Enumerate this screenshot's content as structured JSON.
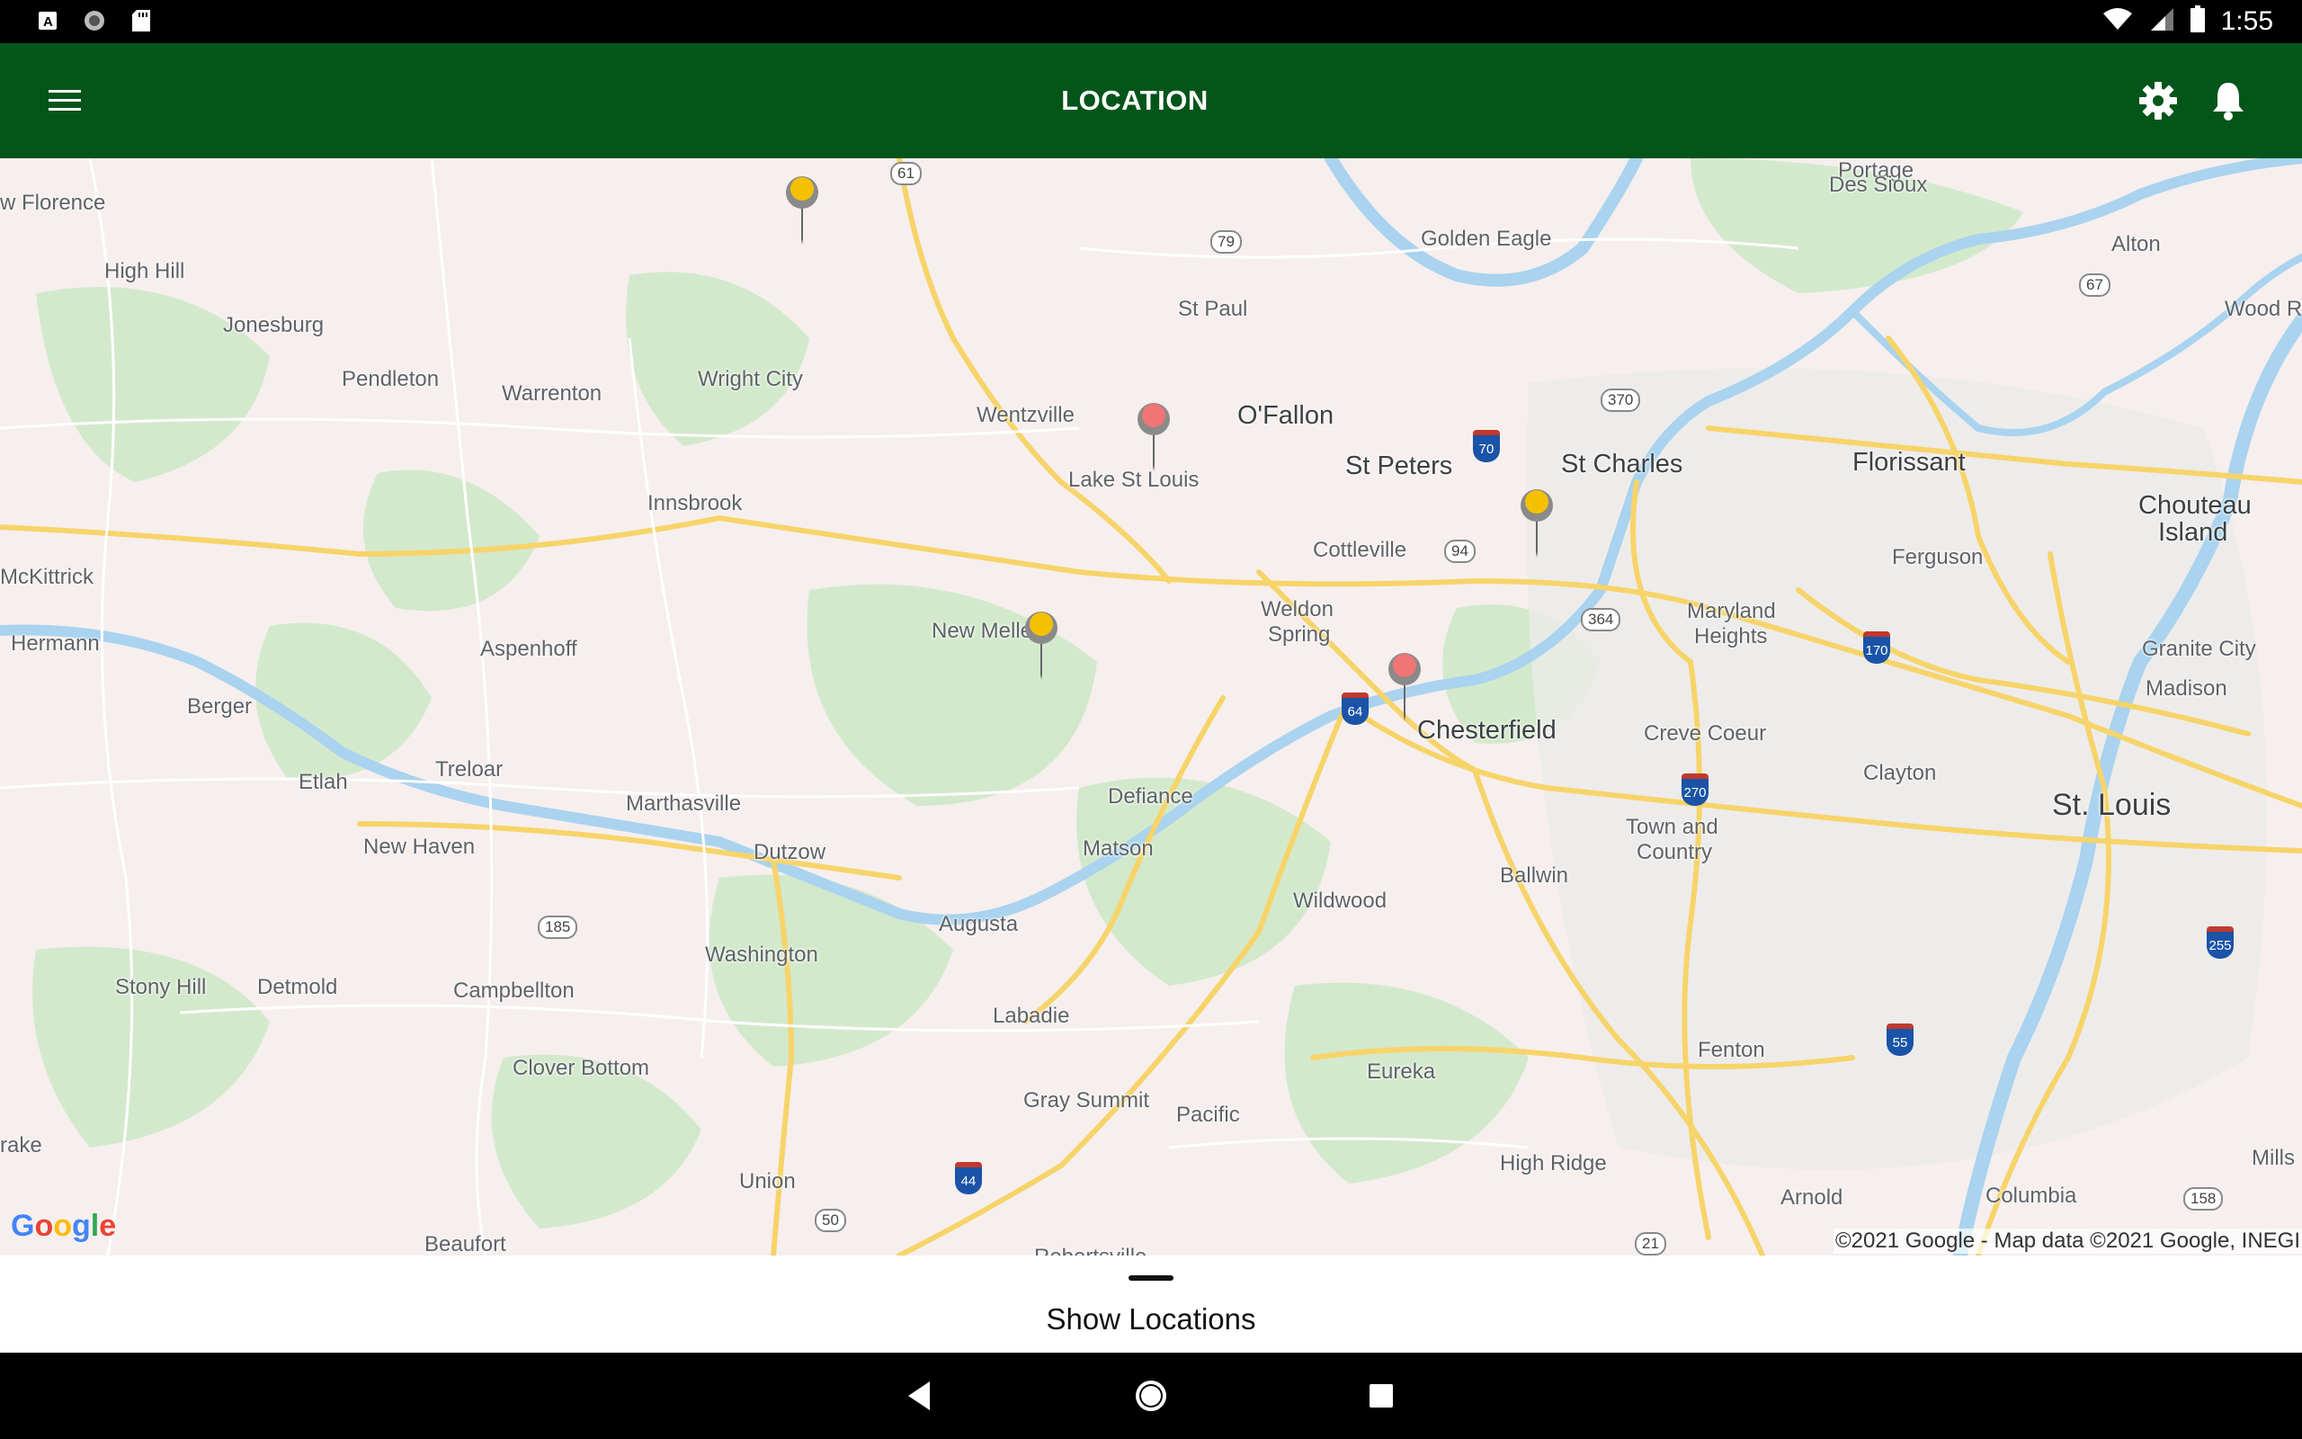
{
  "status_bar": {
    "time": "1:55",
    "icons": [
      "a-icon",
      "circle-icon",
      "sd-card-icon",
      "wifi-icon",
      "signal-icon",
      "battery-icon"
    ]
  },
  "app_bar": {
    "title": "LOCATION",
    "color": "#03551a"
  },
  "map": {
    "places": {
      "florence": "w Florence",
      "high_hill": "High Hill",
      "jonesburg": "Jonesburg",
      "pendleton": "Pendleton",
      "warrenton": "Warrenton",
      "wright_city": "Wright City",
      "wentzville": "Wentzville",
      "ofallon": "O'Fallon",
      "st_paul": "St Paul",
      "golden_eagle": "Golden Eagle",
      "portage": "Portage",
      "des_sioux": "Des Sioux",
      "alton": "Alton",
      "wood_r": "Wood R",
      "st_peters": "St Peters",
      "st_charles": "St Charles",
      "florissant": "Florissant",
      "chouteau": "Chouteau",
      "island": "Island",
      "lake_st_louis": "Lake St Louis",
      "innsbrook": "Innsbrook",
      "cottleville": "Cottleville",
      "ferguson": "Ferguson",
      "mckittrick": "McKittrick",
      "hermann": "Hermann",
      "aspenhoff": "Aspenhoff",
      "new_melle": "New Melle",
      "weldon": "Weldon",
      "spring": "Spring",
      "maryland": "Maryland",
      "heights": "Heights",
      "granite_city": "Granite City",
      "madison": "Madison",
      "berger": "Berger",
      "etlah": "Etlah",
      "treloar": "Treloar",
      "chesterfield": "Chesterfield",
      "creve_coeur": "Creve Coeur",
      "clayton": "Clayton",
      "st_louis": "St. Louis",
      "defiance": "Defiance",
      "marthasville": "Marthasville",
      "new_haven": "New Haven",
      "dutzow": "Dutzow",
      "matson": "Matson",
      "town_and": "Town and",
      "country": "Country",
      "ballwin": "Ballwin",
      "wildwood": "Wildwood",
      "augusta": "Augusta",
      "washington": "Washington",
      "stony_hill": "Stony Hill",
      "detmold": "Detmold",
      "campbellton": "Campbellton",
      "labadie": "Labadie",
      "clover_bottom": "Clover Bottom",
      "fenton": "Fenton",
      "gray_summit": "Gray Summit",
      "pacific": "Pacific",
      "eureka": "Eureka",
      "high_ridge": "High Ridge",
      "union": "Union",
      "arnold": "Arnold",
      "columbia": "Columbia",
      "rake": "rake",
      "mills": "Mills",
      "beaufort": "Beaufort",
      "robertsville": "Robertsville"
    },
    "routes": [
      "61",
      "79",
      "370",
      "67",
      "94",
      "364",
      "185",
      "50",
      "21",
      "158"
    ],
    "interstates": [
      "70",
      "64",
      "270",
      "170",
      "255",
      "55",
      "44"
    ],
    "pins": [
      {
        "name": "pin-yellow-north",
        "color": "#f5c000"
      },
      {
        "name": "pin-red-lake-st-louis",
        "color": "#f07575"
      },
      {
        "name": "pin-yellow-st-charles",
        "color": "#f5c000"
      },
      {
        "name": "pin-yellow-new-melle",
        "color": "#f5c000"
      },
      {
        "name": "pin-red-chesterfield",
        "color": "#f07575"
      }
    ],
    "google_logo": {
      "g1": "G",
      "o1": "o",
      "o2": "o",
      "g2": "g",
      "l": "l",
      "e": "e"
    },
    "copyright": "©2021 Google - Map data ©2021 Google, INEGI"
  },
  "sheet": {
    "label": "Show Locations"
  },
  "nav": {
    "back": "back-icon",
    "home": "home-icon",
    "recents": "recents-icon"
  }
}
